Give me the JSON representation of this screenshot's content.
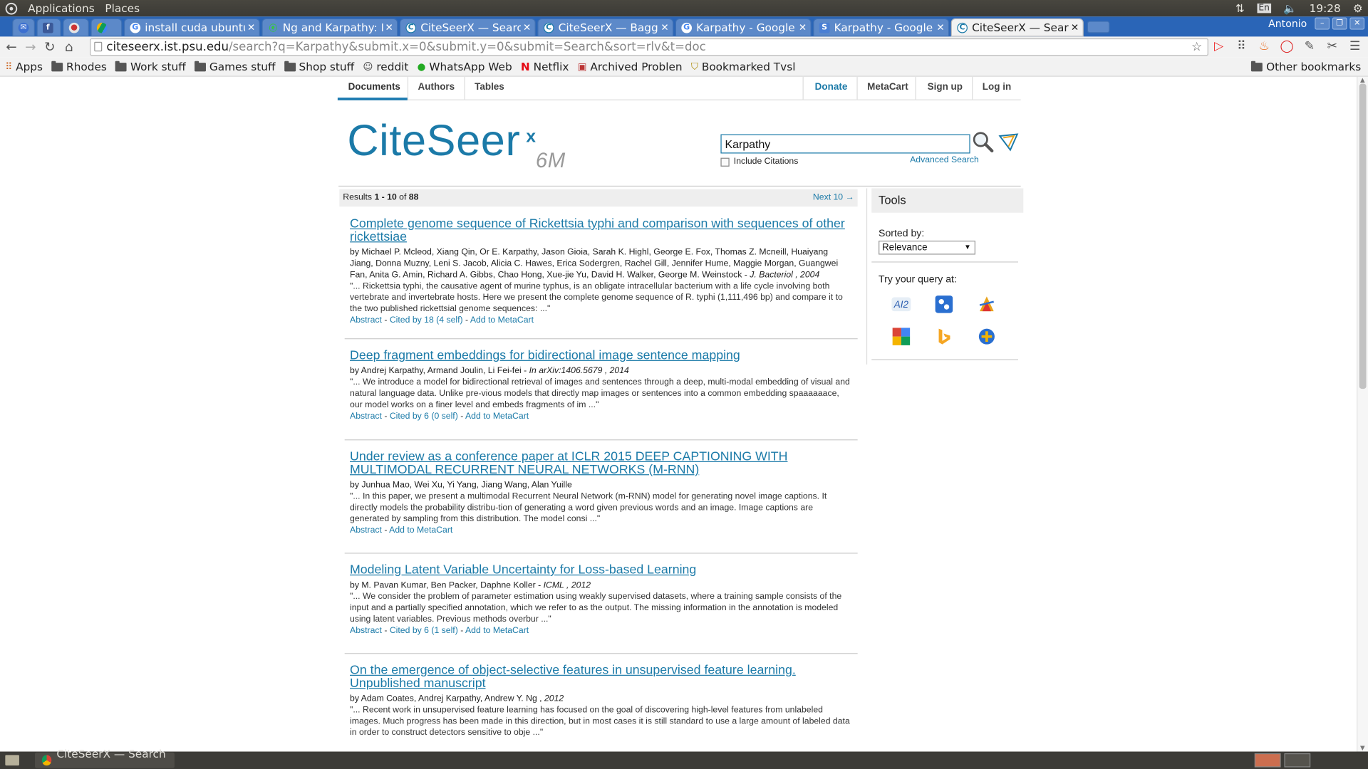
{
  "system_bar": {
    "menu1": "Applications",
    "menu2": "Places",
    "time": "19:28",
    "lang": "En"
  },
  "window": {
    "user": "Antonio"
  },
  "tabs": [
    {
      "title": "",
      "icon": "mail-icon"
    },
    {
      "title": "",
      "icon": "facebook-icon"
    },
    {
      "title": "",
      "icon": "app-icon"
    },
    {
      "title": "",
      "icon": "drive-icon"
    },
    {
      "title": "install cuda ubuntu",
      "icon": "google-icon"
    },
    {
      "title": "Ng and Karpathy: Fir",
      "icon": "leaf-icon"
    },
    {
      "title": "CiteSeerX — Search R",
      "icon": "citeseer-icon"
    },
    {
      "title": "CiteSeerX — Bagging",
      "icon": "citeseer-icon"
    },
    {
      "title": "Karpathy - Google Se",
      "icon": "google-icon"
    },
    {
      "title": "Karpathy - Google Sc",
      "icon": "scholar-icon"
    },
    {
      "title": "CiteSeerX — Search R",
      "icon": "citeseer-icon",
      "active": true
    }
  ],
  "address": {
    "host": "citeseerx.ist.psu.edu",
    "path": "/search?q=Karpathy&submit.x=0&submit.y=0&submit=Search&sort=rlv&t=doc"
  },
  "bookmarks": [
    {
      "label": "Apps",
      "type": "apps"
    },
    {
      "label": "Rhodes",
      "type": "folder"
    },
    {
      "label": "Work stuff",
      "type": "folder"
    },
    {
      "label": "Games stuff",
      "type": "folder"
    },
    {
      "label": "Shop stuff",
      "type": "folder"
    },
    {
      "label": "reddit",
      "type": "site"
    },
    {
      "label": "WhatsApp Web",
      "type": "site"
    },
    {
      "label": "Netflix",
      "type": "site"
    },
    {
      "label": "Archived Problen",
      "type": "site"
    },
    {
      "label": "Bookmarked Tvsl",
      "type": "site"
    }
  ],
  "other_bookmarks": "Other bookmarks",
  "site": {
    "nav": {
      "documents": "Documents",
      "authors": "Authors",
      "tables": "Tables",
      "donate": "Donate",
      "metacart": "MetaCart",
      "signup": "Sign up",
      "login": "Log in"
    },
    "logo": {
      "text": "CiteSeer",
      "sup": "x",
      "count": "6M"
    },
    "search": {
      "value": "Karpathy",
      "include_citations": "Include Citations",
      "advanced": "Advanced Search"
    },
    "results_header": {
      "label": "Results ",
      "range": "1 - 10",
      "of": " of ",
      "total": "88",
      "next": "Next 10 →"
    },
    "results": [
      {
        "title": "Complete genome sequence of Rickettsia typhi and comparison with sequences of other rickettsiae",
        "authors": "by Michael P. Mcleod, Xiang Qin, Or E. Karpathy, Jason Gioia, Sarah K. Highl, George E. Fox, Thomas Z. Mcneill, Huaiyang Jiang, Donna Muzny, Leni S. Jacob, Alicia C. Hawes, Erica Sodergren, Rachel Gill, Jennifer Hume, Maggie Morgan, Guangwei Fan, Anita G. Amin, Richard A. Gibbs, Chao Hong, Xue-jie Yu, David H. Walker, George M. Weinstock - ",
        "venue": "J. Bacteriol , 2004",
        "snippet": "\"... Rickettsia typhi, the causative agent of murine typhus, is an obligate intracellular bacterium with a life cycle involving both vertebrate and invertebrate hosts. Here we present the complete genome sequence of R. typhi (1,111,496 bp) and compare it to the two published rickettsial genome sequences: ...\"",
        "abstract": "Abstract",
        "cited": "Cited by 18 (4 self)",
        "add": "Add to MetaCart"
      },
      {
        "title": "Deep fragment embeddings for bidirectional image sentence mapping",
        "authors": "by Andrej Karpathy, Armand Joulin, Li Fei-fei - ",
        "venue": "In arXiv:1406.5679 , 2014",
        "snippet": "\"... We introduce a model for bidirectional retrieval of images and sentences through a deep, multi-modal embedding of visual and natural language data. Unlike pre-vious models that directly map images or sentences into a common embedding spaaaaaace, our model works on a finer level and embeds fragments of im ...\"",
        "abstract": "Abstract",
        "cited": "Cited by 6 (0 self)",
        "add": "Add to MetaCart"
      },
      {
        "title": "Under review as a conference paper at ICLR 2015 DEEP CAPTIONING WITH MULTIMODAL RECURRENT NEURAL NETWORKS (M-RNN)",
        "authors": "by Junhua Mao, Wei Xu, Yi Yang, Jiang Wang, Alan Yuille",
        "venue": "",
        "snippet": "\"... In this paper, we present a multimodal Recurrent Neural Network (m-RNN) model for generating novel image captions. It directly models the probability distribu-tion of generating a word given previous words and an image. Image captions are generated by sampling from this distribution. The model consi ...\"",
        "abstract": "Abstract",
        "cited": "",
        "add": "Add to MetaCart"
      },
      {
        "title": "Modeling Latent Variable Uncertainty for Loss-based Learning",
        "authors": "by M. Pavan Kumar, Ben Packer, Daphne Koller - ",
        "venue": "ICML , 2012",
        "snippet": "\"... We consider the problem of parameter estimation using weakly supervised datasets, where a training sample consists of the input and a partially specified annotation, which we refer to as the output. The missing information in the annotation is modeled using latent variables. Previous methods overbur ...\"",
        "abstract": "Abstract",
        "cited": "Cited by 6 (1 self)",
        "add": "Add to MetaCart"
      },
      {
        "title": "On the emergence of object-selective features in unsupervised feature learning. Unpublished manuscript",
        "authors": "by Adam Coates, Andrej Karpathy, Andrew Y. Ng , ",
        "venue": "2012",
        "snippet": "\"... Recent work in unsupervised feature learning has focused on the goal of discovering high-level features from unlabeled images. Much progress has been made in this direction, but in most cases it is still standard to use a large amount of labeled data in order to construct detectors sensitive to obje ...\"",
        "abstract": "",
        "cited": "",
        "add": ""
      }
    ],
    "tools": {
      "title": "Tools",
      "sorted_by": "Sorted by:",
      "sort_value": "Relevance",
      "try": "Try your query at:",
      "engines": [
        {
          "label": "AI2",
          "icon": "ai2-icon"
        },
        {
          "label": "",
          "icon": "citeseer-icon"
        },
        {
          "label": "",
          "icon": "csb-icon"
        },
        {
          "label": "",
          "icon": "google-icon"
        },
        {
          "label": "",
          "icon": "bing-icon"
        },
        {
          "label": "",
          "icon": "dblp-icon"
        }
      ]
    }
  },
  "taskbar": {
    "task": "CiteSeerX — Search ..."
  }
}
